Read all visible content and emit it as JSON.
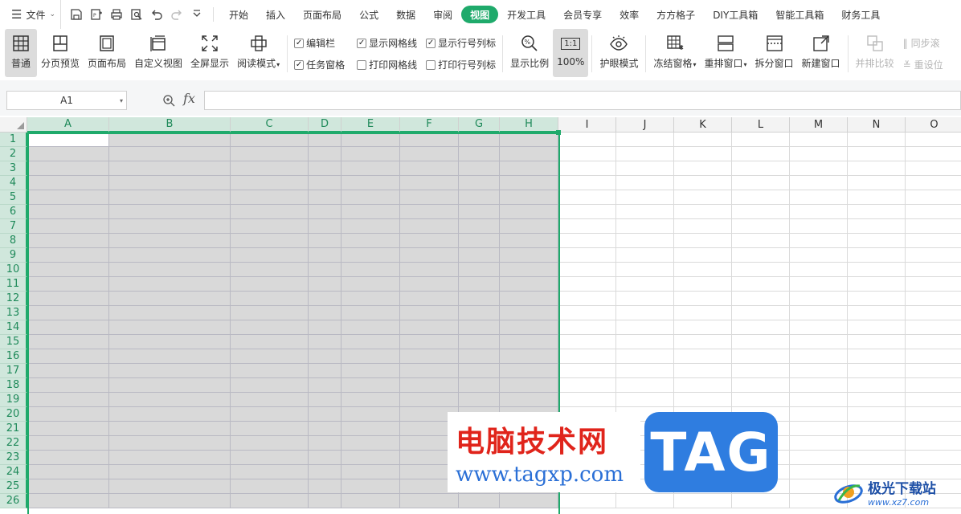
{
  "menubar": {
    "file_label": "文件",
    "tabs": [
      {
        "label": "开始",
        "active": false
      },
      {
        "label": "插入",
        "active": false
      },
      {
        "label": "页面布局",
        "active": false
      },
      {
        "label": "公式",
        "active": false
      },
      {
        "label": "数据",
        "active": false
      },
      {
        "label": "审阅",
        "active": false
      },
      {
        "label": "视图",
        "active": true
      },
      {
        "label": "开发工具",
        "active": false
      },
      {
        "label": "会员专享",
        "active": false
      },
      {
        "label": "效率",
        "active": false
      },
      {
        "label": "方方格子",
        "active": false
      },
      {
        "label": "DIY工具箱",
        "active": false
      },
      {
        "label": "智能工具箱",
        "active": false
      },
      {
        "label": "财务工具",
        "active": false
      }
    ]
  },
  "ribbon": {
    "normal": "普通",
    "page_break_preview": "分页预览",
    "page_layout": "页面布局",
    "custom_view": "自定义视图",
    "full_screen": "全屏显示",
    "reading_mode": "阅读模式",
    "checks": {
      "edit_bar": {
        "label": "编辑栏",
        "checked": true
      },
      "show_gridlines": {
        "label": "显示网格线",
        "checked": true
      },
      "show_headers": {
        "label": "显示行号列标",
        "checked": true
      },
      "task_pane": {
        "label": "任务窗格",
        "checked": true
      },
      "print_gridlines": {
        "label": "打印网格线",
        "checked": false
      },
      "print_headers": {
        "label": "打印行号列标",
        "checked": false
      }
    },
    "zoom": "显示比例",
    "zoom_100": "100%",
    "zoom_100_icon_text": "1:1",
    "eye_protection": "护眼模式",
    "freeze_panes": "冻结窗格",
    "arrange_windows": "重排窗口",
    "split_window": "拆分窗口",
    "new_window": "新建窗口",
    "side_by_side": "并排比较",
    "sync_scroll": "同步滚",
    "reset_position": "重设位"
  },
  "formula_bar": {
    "name_box": "A1",
    "fx": "fx"
  },
  "grid": {
    "columns": [
      "A",
      "B",
      "C",
      "D",
      "E",
      "F",
      "G",
      "H",
      "I",
      "J",
      "K",
      "L",
      "M",
      "N",
      "O"
    ],
    "rows": [
      "1",
      "2",
      "3",
      "4",
      "5",
      "6",
      "7",
      "8",
      "9",
      "10",
      "11",
      "12",
      "13",
      "14",
      "15",
      "16",
      "17",
      "18",
      "19",
      "20",
      "21",
      "22",
      "23",
      "24",
      "25",
      "26"
    ],
    "selected_columns": [
      "A",
      "B",
      "C",
      "D",
      "E",
      "F",
      "G",
      "H"
    ],
    "active_cell": "A1"
  },
  "watermarks": {
    "site_cn": "电脑技术网",
    "site_url": "www.tagxp.com",
    "tag": "TAG",
    "brand_cn": "极光下载站",
    "brand_url": "www.xz7.com"
  },
  "colors": {
    "accent": "#1faa6b",
    "selection_fill": "#d9d9d9",
    "header_selected": "#d0e7dc"
  }
}
